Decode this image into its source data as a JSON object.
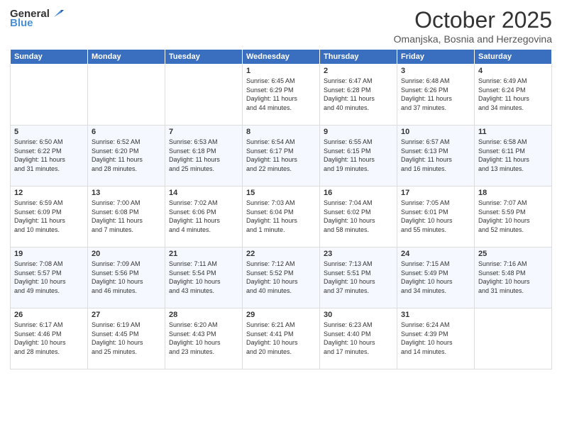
{
  "logo": {
    "general": "General",
    "blue": "Blue"
  },
  "header": {
    "title": "October 2025",
    "subtitle": "Omanjska, Bosnia and Herzegovina"
  },
  "weekdays": [
    "Sunday",
    "Monday",
    "Tuesday",
    "Wednesday",
    "Thursday",
    "Friday",
    "Saturday"
  ],
  "weeks": [
    [
      {
        "day": "",
        "info": ""
      },
      {
        "day": "",
        "info": ""
      },
      {
        "day": "",
        "info": ""
      },
      {
        "day": "1",
        "info": "Sunrise: 6:45 AM\nSunset: 6:29 PM\nDaylight: 11 hours\nand 44 minutes."
      },
      {
        "day": "2",
        "info": "Sunrise: 6:47 AM\nSunset: 6:28 PM\nDaylight: 11 hours\nand 40 minutes."
      },
      {
        "day": "3",
        "info": "Sunrise: 6:48 AM\nSunset: 6:26 PM\nDaylight: 11 hours\nand 37 minutes."
      },
      {
        "day": "4",
        "info": "Sunrise: 6:49 AM\nSunset: 6:24 PM\nDaylight: 11 hours\nand 34 minutes."
      }
    ],
    [
      {
        "day": "5",
        "info": "Sunrise: 6:50 AM\nSunset: 6:22 PM\nDaylight: 11 hours\nand 31 minutes."
      },
      {
        "day": "6",
        "info": "Sunrise: 6:52 AM\nSunset: 6:20 PM\nDaylight: 11 hours\nand 28 minutes."
      },
      {
        "day": "7",
        "info": "Sunrise: 6:53 AM\nSunset: 6:18 PM\nDaylight: 11 hours\nand 25 minutes."
      },
      {
        "day": "8",
        "info": "Sunrise: 6:54 AM\nSunset: 6:17 PM\nDaylight: 11 hours\nand 22 minutes."
      },
      {
        "day": "9",
        "info": "Sunrise: 6:55 AM\nSunset: 6:15 PM\nDaylight: 11 hours\nand 19 minutes."
      },
      {
        "day": "10",
        "info": "Sunrise: 6:57 AM\nSunset: 6:13 PM\nDaylight: 11 hours\nand 16 minutes."
      },
      {
        "day": "11",
        "info": "Sunrise: 6:58 AM\nSunset: 6:11 PM\nDaylight: 11 hours\nand 13 minutes."
      }
    ],
    [
      {
        "day": "12",
        "info": "Sunrise: 6:59 AM\nSunset: 6:09 PM\nDaylight: 11 hours\nand 10 minutes."
      },
      {
        "day": "13",
        "info": "Sunrise: 7:00 AM\nSunset: 6:08 PM\nDaylight: 11 hours\nand 7 minutes."
      },
      {
        "day": "14",
        "info": "Sunrise: 7:02 AM\nSunset: 6:06 PM\nDaylight: 11 hours\nand 4 minutes."
      },
      {
        "day": "15",
        "info": "Sunrise: 7:03 AM\nSunset: 6:04 PM\nDaylight: 11 hours\nand 1 minute."
      },
      {
        "day": "16",
        "info": "Sunrise: 7:04 AM\nSunset: 6:02 PM\nDaylight: 10 hours\nand 58 minutes."
      },
      {
        "day": "17",
        "info": "Sunrise: 7:05 AM\nSunset: 6:01 PM\nDaylight: 10 hours\nand 55 minutes."
      },
      {
        "day": "18",
        "info": "Sunrise: 7:07 AM\nSunset: 5:59 PM\nDaylight: 10 hours\nand 52 minutes."
      }
    ],
    [
      {
        "day": "19",
        "info": "Sunrise: 7:08 AM\nSunset: 5:57 PM\nDaylight: 10 hours\nand 49 minutes."
      },
      {
        "day": "20",
        "info": "Sunrise: 7:09 AM\nSunset: 5:56 PM\nDaylight: 10 hours\nand 46 minutes."
      },
      {
        "day": "21",
        "info": "Sunrise: 7:11 AM\nSunset: 5:54 PM\nDaylight: 10 hours\nand 43 minutes."
      },
      {
        "day": "22",
        "info": "Sunrise: 7:12 AM\nSunset: 5:52 PM\nDaylight: 10 hours\nand 40 minutes."
      },
      {
        "day": "23",
        "info": "Sunrise: 7:13 AM\nSunset: 5:51 PM\nDaylight: 10 hours\nand 37 minutes."
      },
      {
        "day": "24",
        "info": "Sunrise: 7:15 AM\nSunset: 5:49 PM\nDaylight: 10 hours\nand 34 minutes."
      },
      {
        "day": "25",
        "info": "Sunrise: 7:16 AM\nSunset: 5:48 PM\nDaylight: 10 hours\nand 31 minutes."
      }
    ],
    [
      {
        "day": "26",
        "info": "Sunrise: 6:17 AM\nSunset: 4:46 PM\nDaylight: 10 hours\nand 28 minutes."
      },
      {
        "day": "27",
        "info": "Sunrise: 6:19 AM\nSunset: 4:45 PM\nDaylight: 10 hours\nand 25 minutes."
      },
      {
        "day": "28",
        "info": "Sunrise: 6:20 AM\nSunset: 4:43 PM\nDaylight: 10 hours\nand 23 minutes."
      },
      {
        "day": "29",
        "info": "Sunrise: 6:21 AM\nSunset: 4:41 PM\nDaylight: 10 hours\nand 20 minutes."
      },
      {
        "day": "30",
        "info": "Sunrise: 6:23 AM\nSunset: 4:40 PM\nDaylight: 10 hours\nand 17 minutes."
      },
      {
        "day": "31",
        "info": "Sunrise: 6:24 AM\nSunset: 4:39 PM\nDaylight: 10 hours\nand 14 minutes."
      },
      {
        "day": "",
        "info": ""
      }
    ]
  ]
}
